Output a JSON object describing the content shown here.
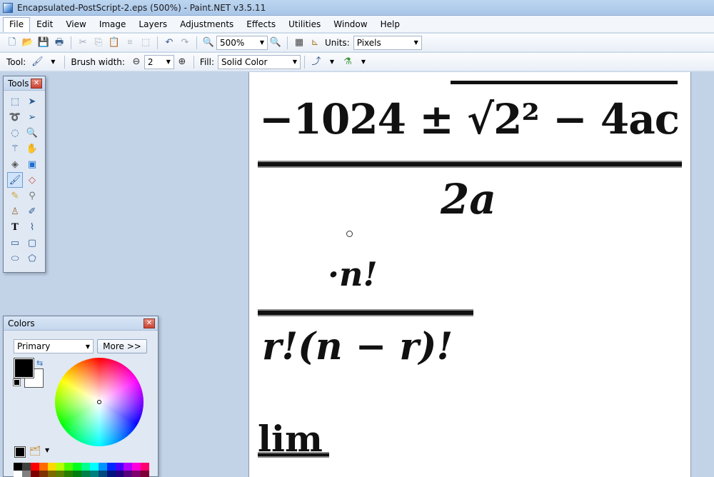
{
  "window": {
    "title": "Encapsulated-PostScript-2.eps (500%) - Paint.NET v3.5.11"
  },
  "menu": [
    "File",
    "Edit",
    "View",
    "Image",
    "Layers",
    "Adjustments",
    "Effects",
    "Utilities",
    "Window",
    "Help"
  ],
  "toolbar1": {
    "zoom_value": "500%",
    "units_label": "Units:",
    "units_value": "Pixels"
  },
  "toolbar2": {
    "tool_label": "Tool:",
    "brush_width_label": "Brush width:",
    "brush_width_value": "2",
    "fill_label": "Fill:",
    "fill_value": "Solid Color"
  },
  "tools_panel": {
    "title": "Tools"
  },
  "colors_panel": {
    "title": "Colors",
    "mode_value": "Primary",
    "more_label": "More >>",
    "primary_color": "#000000",
    "secondary_color": "#ffffff",
    "palette_colors": [
      "#000000",
      "#404040",
      "#ff0000",
      "#ff6a00",
      "#ffd800",
      "#b6ff00",
      "#4cff00",
      "#00ff21",
      "#00ff90",
      "#00ffff",
      "#0094ff",
      "#0026ff",
      "#4800ff",
      "#b200ff",
      "#ff00dc",
      "#ff006e",
      "#ffffff",
      "#808080",
      "#7f0000",
      "#7f3300",
      "#7f6a00",
      "#5b7f00",
      "#267f00",
      "#007f0e",
      "#007f46",
      "#007f7f",
      "#004a7f",
      "#00137f",
      "#21007f",
      "#57007f",
      "#7f006e",
      "#7f0037"
    ]
  },
  "canvas": {
    "expr_main": "−1024 ± √2² − 4ac",
    "expr_denominator": "2a",
    "expr_numerator2": "·n!",
    "expr_denominator2": "r!(n − r)!",
    "expr_lim": "lim"
  }
}
